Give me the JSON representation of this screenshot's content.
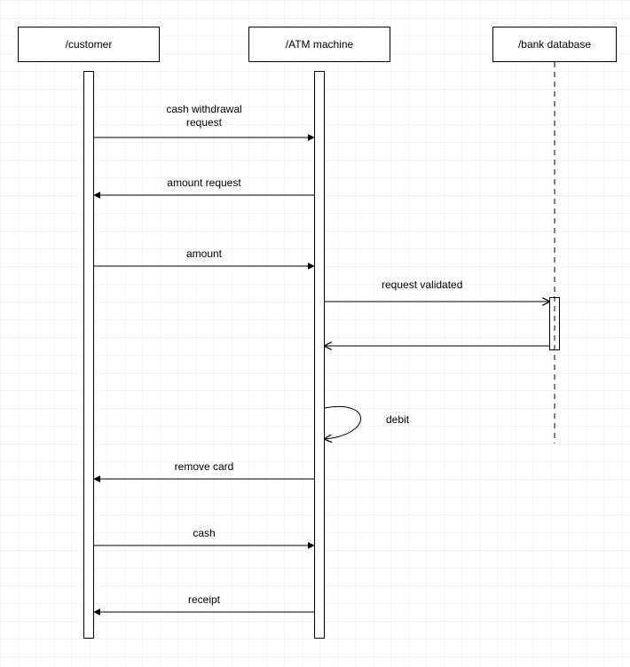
{
  "lifelines": {
    "customer": {
      "label": "/customer"
    },
    "atm": {
      "label": "/ATM machine"
    },
    "bank": {
      "label": "/bank database"
    }
  },
  "messages": {
    "m1": {
      "label": "cash withdrawal\nrequest"
    },
    "m2": {
      "label": "amount request"
    },
    "m3": {
      "label": "amount"
    },
    "m4": {
      "label": "request validated"
    },
    "m5": {
      "label": "debit"
    },
    "m6": {
      "label": "remove card"
    },
    "m7": {
      "label": "cash"
    },
    "m8": {
      "label": "receipt"
    }
  },
  "chart_data": {
    "type": "sequence-diagram",
    "lifelines": [
      {
        "id": "customer",
        "name": "/customer"
      },
      {
        "id": "atm",
        "name": "/ATM machine"
      },
      {
        "id": "bank",
        "name": "/bank database"
      }
    ],
    "activations": [
      {
        "lifeline": "customer",
        "from_step": 0,
        "to_step": 9
      },
      {
        "lifeline": "atm",
        "from_step": 0,
        "to_step": 9
      },
      {
        "lifeline": "bank",
        "from_step": 4,
        "to_step": 5
      }
    ],
    "messages": [
      {
        "step": 1,
        "from": "customer",
        "to": "atm",
        "label": "cash withdrawal request",
        "kind": "sync"
      },
      {
        "step": 2,
        "from": "atm",
        "to": "customer",
        "label": "amount request",
        "kind": "sync"
      },
      {
        "step": 3,
        "from": "customer",
        "to": "atm",
        "label": "amount",
        "kind": "sync"
      },
      {
        "step": 4,
        "from": "atm",
        "to": "bank",
        "label": "request validated",
        "kind": "sync"
      },
      {
        "step": 5,
        "from": "bank",
        "to": "atm",
        "label": "",
        "kind": "return"
      },
      {
        "step": 6,
        "from": "atm",
        "to": "atm",
        "label": "debit",
        "kind": "self"
      },
      {
        "step": 7,
        "from": "atm",
        "to": "customer",
        "label": "remove card",
        "kind": "sync"
      },
      {
        "step": 8,
        "from": "customer",
        "to": "atm",
        "label": "cash",
        "kind": "sync"
      },
      {
        "step": 9,
        "from": "atm",
        "to": "customer",
        "label": "receipt",
        "kind": "sync"
      }
    ]
  }
}
